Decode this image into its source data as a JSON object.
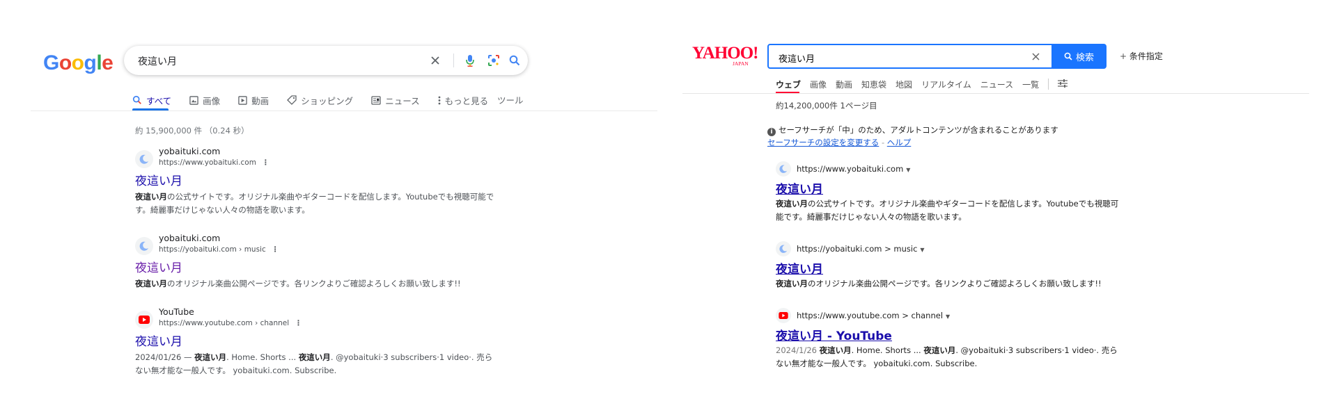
{
  "google": {
    "logo": {
      "letters": [
        "G",
        "o",
        "o",
        "g",
        "l",
        "e"
      ],
      "colors": [
        "#4285F4",
        "#EA4335",
        "#FBBC05",
        "#4285F4",
        "#34A853",
        "#EA4335"
      ]
    },
    "search": {
      "query": "夜這い月"
    },
    "tabs": [
      {
        "label": "すべて",
        "icon": "search-icon"
      },
      {
        "label": "画像",
        "icon": "image-icon"
      },
      {
        "label": "動画",
        "icon": "video-icon"
      },
      {
        "label": "ショッピング",
        "icon": "tag-icon"
      },
      {
        "label": "ニュース",
        "icon": "news-icon"
      },
      {
        "label": "もっと見る",
        "icon": "more-vert-icon"
      }
    ],
    "tools_label": "ツール",
    "stats": "約 15,900,000 件 （0.24 秒）",
    "results": [
      {
        "site": "yobaituki.com",
        "url": "https://www.yobaituki.com",
        "title": "夜這い月",
        "snippet_bold": "夜這い月",
        "snippet_rest": "の公式サイトです。オリジナル楽曲やギターコードを配信します。Youtubeでも視聴可能です。綺麗事だけじゃない人々の物語を歌います。"
      },
      {
        "site": "yobaituki.com",
        "url": "https://yobaituki.com › music",
        "title": "夜這い月",
        "snippet_bold": "夜這い月",
        "snippet_rest": "のオリジナル楽曲公開ページです。各リンクよりご確認よろしくお願い致します!!"
      },
      {
        "site": "YouTube",
        "url": "https://www.youtube.com › channel",
        "title": "夜這い月",
        "date": "2024/01/26 — ",
        "snippet_bold1": "夜這い月",
        "snippet_mid1": ". Home. Shorts ... ",
        "snippet_bold2": "夜這い月",
        "snippet_rest": ". @yobaituki·3 subscribers·1 video·. 売らない無才能な一般人です。 yobaituki.com. Subscribe."
      }
    ]
  },
  "yahoo": {
    "logo": {
      "main": "YAHOO!",
      "sub": "JAPAN"
    },
    "search": {
      "query": "夜這い月",
      "button_label": "検索"
    },
    "conditions_label": "条件指定",
    "tabs": [
      "ウェブ",
      "画像",
      "動画",
      "知恵袋",
      "地図",
      "リアルタイム",
      "ニュース",
      "一覧"
    ],
    "stats": "約14,200,000件  1ページ目",
    "safesearch": {
      "notice": "セーフサーチが「中」のため、アダルトコンテンツが含まれることがあります",
      "settings_link": "セーフサーチの設定を変更する",
      "separator": " - ",
      "help_link": "ヘルプ"
    },
    "results": [
      {
        "url": "https://www.yobaituki.com",
        "title": "夜這い月",
        "snippet_bold": "夜這い月",
        "snippet_rest": "の公式サイトです。オリジナル楽曲やギターコードを配信します。Youtubeでも視聴可能です。綺麗事だけじゃない人々の物語を歌います。"
      },
      {
        "url": "https://yobaituki.com > music",
        "title": "夜這い月",
        "snippet_bold": "夜這い月",
        "snippet_rest": "のオリジナル楽曲公開ページです。各リンクよりご確認よろしくお願い致します!!"
      },
      {
        "url": "https://www.youtube.com > channel",
        "title": "夜這い月 - YouTube",
        "date": "2024/1/26 ",
        "snippet_bold1": "夜這い月",
        "snippet_mid1": ". Home. Shorts ... ",
        "snippet_bold2": "夜這い月",
        "snippet_rest": ". @yobaituki·3 subscribers·1 video·. 売らない無才能な一般人です。 yobaituki.com. Subscribe."
      }
    ]
  }
}
